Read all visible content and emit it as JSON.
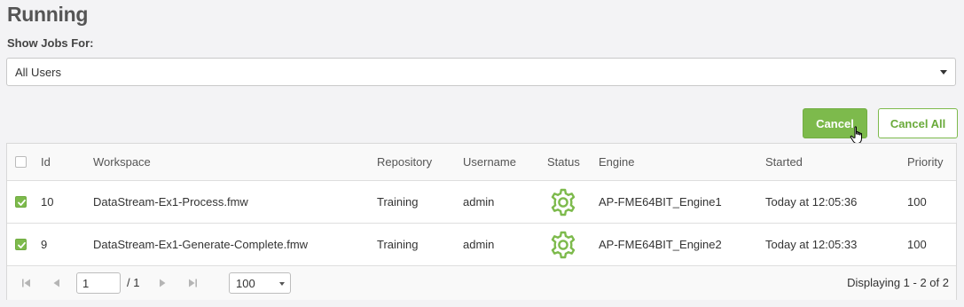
{
  "page": {
    "title": "Running"
  },
  "filter": {
    "label": "Show Jobs For:",
    "selected": "All Users"
  },
  "actions": {
    "cancel_label": "Cancel",
    "cancel_all_label": "Cancel All"
  },
  "table": {
    "headers": {
      "id": "Id",
      "workspace": "Workspace",
      "repository": "Repository",
      "username": "Username",
      "status": "Status",
      "engine": "Engine",
      "started": "Started",
      "priority": "Priority"
    },
    "rows": [
      {
        "checked": true,
        "id": "10",
        "workspace": "DataStream-Ex1-Process.fmw",
        "repository": "Training",
        "username": "admin",
        "status_icon": "gear-icon",
        "engine": "AP-FME64BIT_Engine1",
        "started": "Today at 12:05:36",
        "priority": "100"
      },
      {
        "checked": true,
        "id": "9",
        "workspace": "DataStream-Ex1-Generate-Complete.fmw",
        "repository": "Training",
        "username": "admin",
        "status_icon": "gear-icon",
        "engine": "AP-FME64BIT_Engine2",
        "started": "Today at 12:05:33",
        "priority": "100"
      }
    ]
  },
  "pager": {
    "page_value": "1",
    "page_total": "/ 1",
    "page_size": "100",
    "display_text": "Displaying 1 - 2 of 2"
  },
  "colors": {
    "accent": "#7dba4c",
    "background": "#f3f3f5"
  }
}
